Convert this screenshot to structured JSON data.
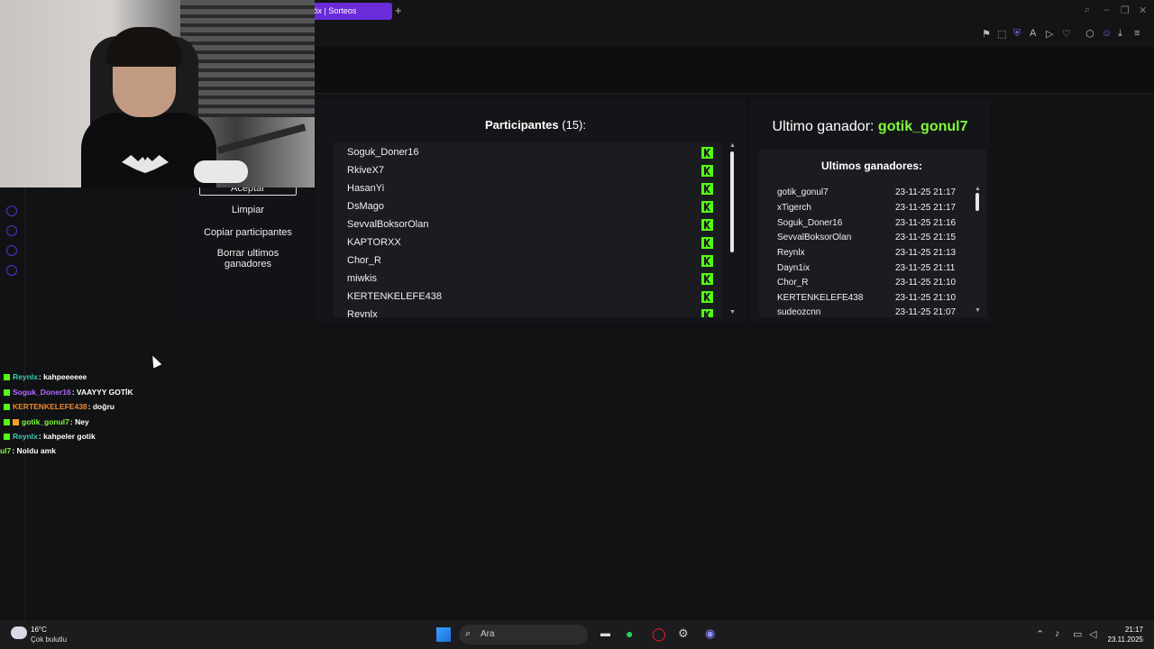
{
  "browser": {
    "tab_title": "Rix | Sorteos",
    "new_tab": "+"
  },
  "controls": {
    "aceptar": "Aceptar",
    "limpiar": "Limpiar",
    "copiar": "Copiar participantes",
    "borrar": "Borrar ultimos ganadores"
  },
  "participants": {
    "title": "Participantes",
    "count": "(15):",
    "items": [
      "Soguk_Doner16",
      "RkiveX7",
      "HasanYi",
      "DsMago",
      "SevvalBoksorOlan",
      "KAPTORXX",
      "Chor_R",
      "miwkis",
      "KERTENKELEFE438",
      "Reynlx"
    ]
  },
  "winner": {
    "label": "Ultimo ganador:",
    "name": "gotik_gonul7"
  },
  "recent_winners": {
    "title": "Ultimos ganadores:",
    "rows": [
      {
        "name": "gotik_gonul7",
        "date": "23-11-25 21:17"
      },
      {
        "name": "xTigerch",
        "date": "23-11-25 21:17"
      },
      {
        "name": "Soguk_Doner16",
        "date": "23-11-25 21:16"
      },
      {
        "name": "SevvalBoksorOlan",
        "date": "23-11-25 21:15"
      },
      {
        "name": "Reynlx",
        "date": "23-11-25 21:13"
      },
      {
        "name": "Dayn1ix",
        "date": "23-11-25 21:11"
      },
      {
        "name": "Chor_R",
        "date": "23-11-25 21:10"
      },
      {
        "name": "KERTENKELEFE438",
        "date": "23-11-25 21:10"
      },
      {
        "name": "sudeozcnn",
        "date": "23-11-25 21:07"
      }
    ]
  },
  "chat": [
    {
      "user": "Reynlx",
      "color": "#40c8b0",
      "text": ": kahpeeeeee"
    },
    {
      "user": "Soguk_Doner16",
      "color": "#b06bff",
      "text": ": VAAYYY GOTİK"
    },
    {
      "user": "KERTENKELEFE438",
      "color": "#f08a2c",
      "text": ": doğru"
    },
    {
      "user": "gotik_gonul7",
      "color": "#7ffb3a",
      "text": ": Ney"
    },
    {
      "user": "Reynlx",
      "color": "#40c8b0",
      "text": ": kahpeler gotik"
    },
    {
      "user": "ul7",
      "color": "#7ffb3a",
      "text": ": Noldu amk"
    }
  ],
  "taskbar": {
    "temp": "16°C",
    "weather": "Çok bulutlu",
    "search_placeholder": "Ara",
    "time": "21:17",
    "date": "23.11.2025"
  },
  "colors": {
    "accent": "#6a2bd9",
    "kick_green": "#53fc18",
    "winner_green": "#7ffb3a"
  }
}
